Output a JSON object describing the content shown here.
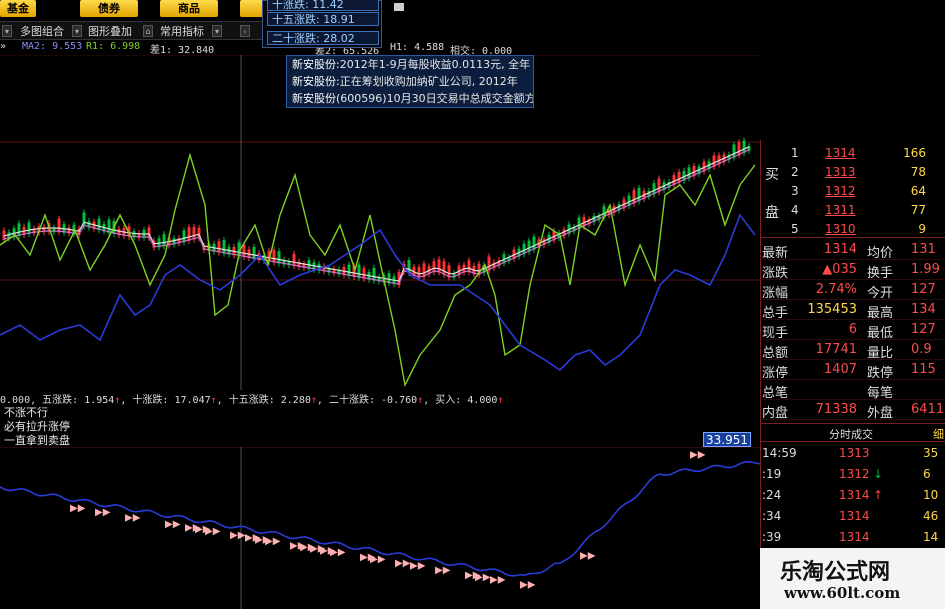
{
  "top_tabs": [
    "基金",
    "债券",
    "商品"
  ],
  "toolbar": {
    "multi_chart": "多图组合",
    "overlay": "图形叠加",
    "common_indicators": "常用指标"
  },
  "indicator_header": {
    "ma2": "MA2: 9.553",
    "r1": "R1: 6.998",
    "diff1": "差1: 32.840",
    "diff2": "差2: 65.526",
    "h1": "H1: 4.588",
    "rel": "相交: 0.000"
  },
  "popup": {
    "line1": "十涨跌: 11.42",
    "line2": "十五涨跌: 18.91",
    "line3": "二十涨跌: 28.02"
  },
  "news": [
    {
      "name": "新安股份:",
      "text": "2012年1-9月每股收益0.0113元, 全年"
    },
    {
      "name": "新安股份:",
      "text": "正在筹划收购加纳矿业公司, 2012年"
    },
    {
      "name": "新安股份",
      "text": "(600596)10月30日交易中总成交金额方"
    }
  ],
  "stat_line": {
    "prefix": "0.000,",
    "items": [
      {
        "label": "五涨跌:",
        "value": "1.954"
      },
      {
        "label": "十涨跌:",
        "value": "17.047"
      },
      {
        "label": "十五涨跌:",
        "value": "2.280"
      },
      {
        "label": "二十涨跌:",
        "value": "-0.760"
      },
      {
        "label": "买入:",
        "value": "4.000"
      }
    ]
  },
  "signals": [
    "不涨不行",
    "必有拉升涨停",
    "一直拿到卖盘"
  ],
  "sub_chart_value": "33.951",
  "order_book": {
    "side_label_1": "买",
    "side_label_2": "盘",
    "rows": [
      {
        "level": "1",
        "price": "1314",
        "volume": "166"
      },
      {
        "level": "2",
        "price": "1313",
        "volume": "78"
      },
      {
        "level": "3",
        "price": "1312",
        "volume": "64"
      },
      {
        "level": "4",
        "price": "1311",
        "volume": "77"
      },
      {
        "level": "5",
        "price": "1310",
        "volume": "9"
      }
    ]
  },
  "quote": [
    {
      "l1": "最新",
      "v1": "1314",
      "l2": "均价",
      "v2": "131"
    },
    {
      "l1": "涨跌",
      "v1": "▲035",
      "l2": "换手",
      "v2": "1.99"
    },
    {
      "l1": "涨幅",
      "v1": "2.74%",
      "l2": "今开",
      "v2": "127"
    },
    {
      "l1": "总手",
      "v1": "135453",
      "l2": "最高",
      "v2": "134"
    },
    {
      "l1": "现手",
      "v1": "6",
      "l2": "最低",
      "v2": "127"
    },
    {
      "l1": "总额",
      "v1": "17741",
      "l2": "量比",
      "v2": "0.9"
    },
    {
      "l1": "涨停",
      "v1": "1407",
      "l2": "跌停",
      "v2": "115"
    },
    {
      "l1": "总笔",
      "v1": "",
      "l2": "每笔",
      "v2": ""
    },
    {
      "l1": "内盘",
      "v1": "71338",
      "l2": "外盘",
      "v2": "6411"
    }
  ],
  "trades_title": "分时成交",
  "trades_tab": "细",
  "trades": [
    {
      "time": "14:59",
      "price": "1313",
      "arrow": "",
      "volume": "35"
    },
    {
      "time": ":19",
      "price": "1312",
      "arrow": "↓",
      "volume": "6"
    },
    {
      "time": ":24",
      "price": "1314",
      "arrow": "↑",
      "volume": "10"
    },
    {
      "time": ":34",
      "price": "1314",
      "arrow": "",
      "volume": "46"
    },
    {
      "time": ":39",
      "price": "1314",
      "arrow": "",
      "volume": "14"
    }
  ],
  "watermark": {
    "title": "乐淘公式网",
    "url": "www.60lt.com"
  },
  "colors": {
    "up": "#ff4040",
    "down": "#00c040",
    "ma_white": "#e0e0e0",
    "ma_yellow": "#ffd84a",
    "osc_green": "#7ed321",
    "osc_blue": "#2b3bd8"
  }
}
